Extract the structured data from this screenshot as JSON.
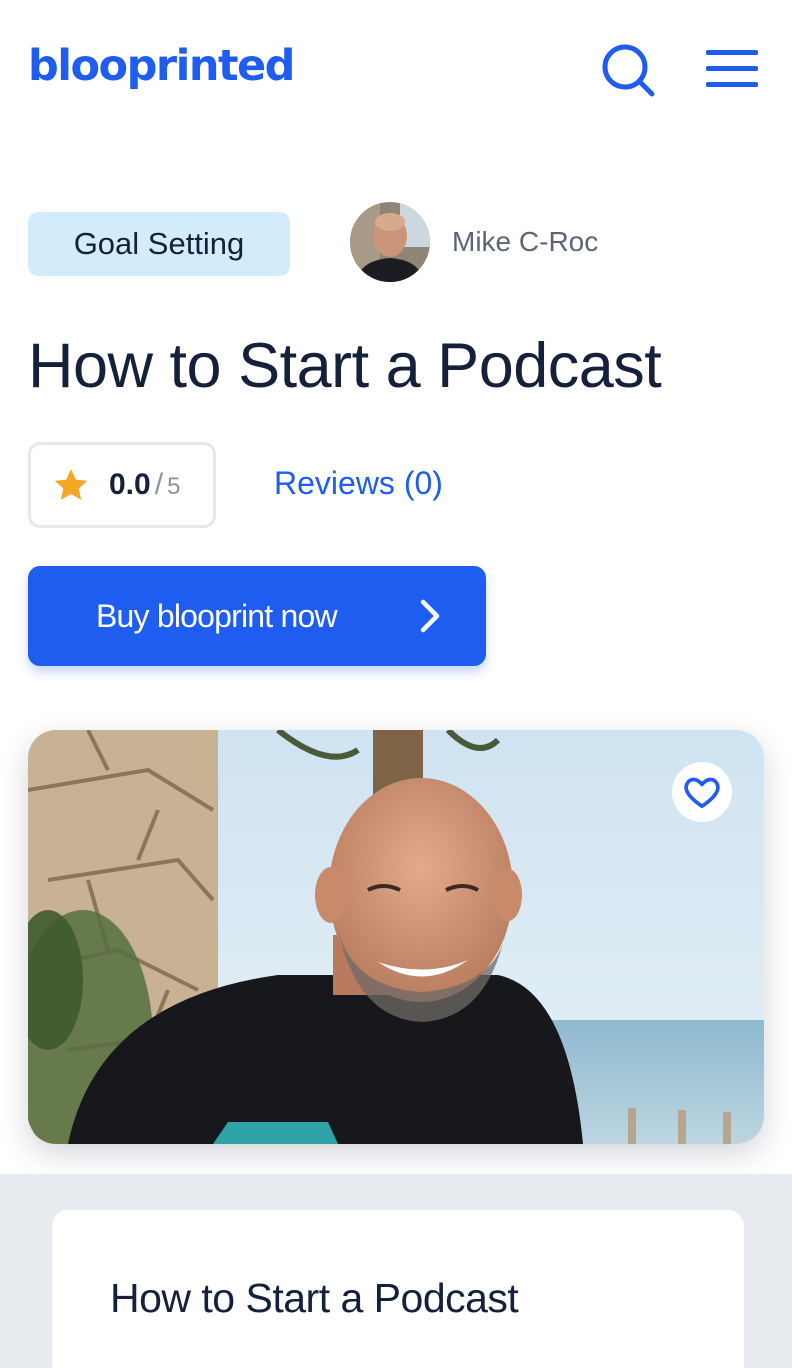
{
  "header": {
    "logo_text": "blooprinted",
    "search_icon": "search-icon",
    "menu_icon": "hamburger-menu-icon",
    "brand_color": "#1f5cf0"
  },
  "blooprint": {
    "category": "Goal Setting",
    "author_name": "Mike C-Roc",
    "title": "How to Start a Podcast",
    "rating": {
      "value": "0.0",
      "separator": "/",
      "max": "5",
      "star_color": "#f5a623"
    },
    "reviews_label": "Reviews (0)",
    "buy_label": "Buy blooprint now",
    "favorite_icon": "heart-icon"
  },
  "content_card": {
    "title": "How to Start a Podcast"
  }
}
